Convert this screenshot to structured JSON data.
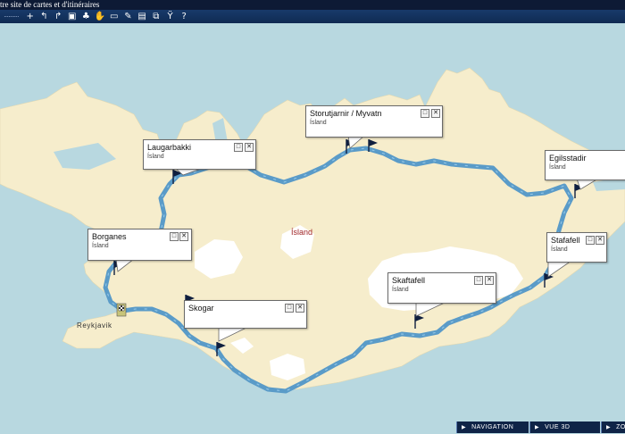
{
  "app": {
    "title": "tre site de cartes et d'itinéraires"
  },
  "toolbar": {
    "handle": "··········",
    "tools": [
      {
        "name": "zoom-in-icon",
        "glyph": "+"
      },
      {
        "name": "back-icon",
        "glyph": "↰"
      },
      {
        "name": "forward-icon",
        "glyph": "↱"
      },
      {
        "name": "lock-icon",
        "glyph": "▣"
      },
      {
        "name": "pin-icon",
        "glyph": "♣"
      },
      {
        "name": "hand-icon",
        "glyph": "✋"
      },
      {
        "name": "ruler-icon",
        "glyph": "▭"
      },
      {
        "name": "route-icon",
        "glyph": "✎"
      },
      {
        "name": "print-icon",
        "glyph": "▤"
      },
      {
        "name": "window-icon",
        "glyph": "⧉"
      },
      {
        "name": "tools-icon",
        "glyph": "Ÿ"
      },
      {
        "name": "help-icon",
        "glyph": "?"
      }
    ]
  },
  "map": {
    "country_label": "Ísland",
    "city_label": "Reykjavik"
  },
  "popups": [
    {
      "name": "Laugarbakki",
      "sub": "Ísland"
    },
    {
      "name": "Storutjarnir / Myvatn",
      "sub": "Ísland"
    },
    {
      "name": "Egilsstadir",
      "sub": "Ísland"
    },
    {
      "name": "Borganes",
      "sub": "Ísland"
    },
    {
      "name": "Stafafell",
      "sub": "Ísland"
    },
    {
      "name": "Skaftafell",
      "sub": "Ísland"
    },
    {
      "name": "Skogar",
      "sub": "Ísland"
    }
  ],
  "bottom_nav": {
    "navigation": "NAVIGATION",
    "vue3d": "VUE 3D",
    "zoom": "ZO"
  },
  "colors": {
    "water": "#b8d8e0",
    "land": "#f6edcc",
    "route": "#5a9bc8",
    "glacier": "#ffffff",
    "toolbar": "#13305c"
  }
}
